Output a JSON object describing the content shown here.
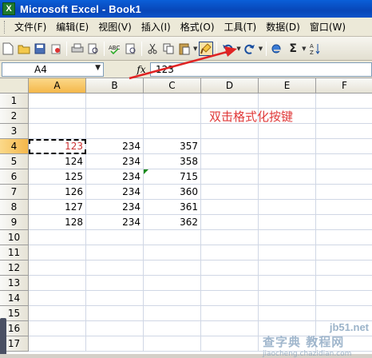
{
  "window": {
    "title": "Microsoft Excel - Book1",
    "app_icon": "X"
  },
  "menubar": {
    "items": [
      "文件(F)",
      "编辑(E)",
      "视图(V)",
      "插入(I)",
      "格式(O)",
      "工具(T)",
      "数据(D)",
      "窗口(W)"
    ]
  },
  "toolbar": {
    "icons": [
      "new-icon",
      "open-icon",
      "save-icon",
      "permission-icon",
      "print-icon",
      "print-preview-icon",
      "spelling-icon",
      "cut-icon",
      "copy-icon",
      "paste-icon",
      "format-painter-icon",
      "undo-icon",
      "redo-icon",
      "hyperlink-icon",
      "autosum-icon",
      "sort-icon"
    ],
    "autosum_glyph": "Σ"
  },
  "formula_bar": {
    "name_box": "A4",
    "fx": "fx",
    "value": "123"
  },
  "sheet": {
    "columns": [
      "A",
      "B",
      "C",
      "D",
      "E",
      "F"
    ],
    "rows": [
      "1",
      "2",
      "3",
      "4",
      "5",
      "6",
      "7",
      "8",
      "9",
      "10",
      "11",
      "12",
      "13",
      "14",
      "15",
      "16",
      "17"
    ],
    "selected_cell": "A4",
    "cells": [
      {
        "ref": "A4",
        "value": "123"
      },
      {
        "ref": "B4",
        "value": "234"
      },
      {
        "ref": "C4",
        "value": "357"
      },
      {
        "ref": "A5",
        "value": "124"
      },
      {
        "ref": "B5",
        "value": "234"
      },
      {
        "ref": "C5",
        "value": "358"
      },
      {
        "ref": "A6",
        "value": "125"
      },
      {
        "ref": "B6",
        "value": "234"
      },
      {
        "ref": "C6",
        "value": "715"
      },
      {
        "ref": "A7",
        "value": "126"
      },
      {
        "ref": "B7",
        "value": "234"
      },
      {
        "ref": "C7",
        "value": "360"
      },
      {
        "ref": "A8",
        "value": "127"
      },
      {
        "ref": "B8",
        "value": "234"
      },
      {
        "ref": "C8",
        "value": "361"
      },
      {
        "ref": "A9",
        "value": "128"
      },
      {
        "ref": "B9",
        "value": "234"
      },
      {
        "ref": "C9",
        "value": "362"
      }
    ]
  },
  "annotation": {
    "text": "双击格式化按键",
    "color": "#e03a3a"
  },
  "watermark": {
    "line1": "jb51.net",
    "line2": "查字典 教程网",
    "line3": "jiaocheng.chazidian.com"
  }
}
